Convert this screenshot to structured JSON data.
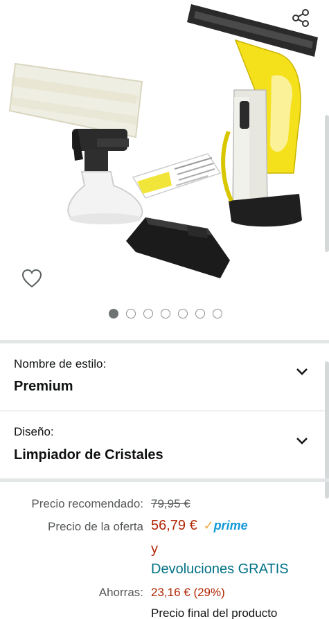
{
  "gallery": {
    "image_count": 7,
    "active_index": 0
  },
  "variations": [
    {
      "label": "Nombre de estilo:",
      "value": "Premium"
    },
    {
      "label": "Diseño:",
      "value": "Limpiador de Cristales"
    }
  ],
  "price": {
    "list_label": "Precio recomendado:",
    "list_value": "79,95 €",
    "deal_label": "Precio de la oferta",
    "deal_value": "56,79 €",
    "prime_check": "✓",
    "prime_label": "prime",
    "and_text": "y",
    "returns_text": "Devoluciones GRATIS",
    "savings_label": "Ahorras:",
    "savings_value": "23,16 € (29%)",
    "final_text": "Precio final del producto"
  },
  "colors": {
    "price_red": "#b12704",
    "link_teal": "#007185",
    "prime_blue": "#1399d6",
    "prime_orange": "#f3a847",
    "karcher_yellow": "#f5e11b"
  }
}
